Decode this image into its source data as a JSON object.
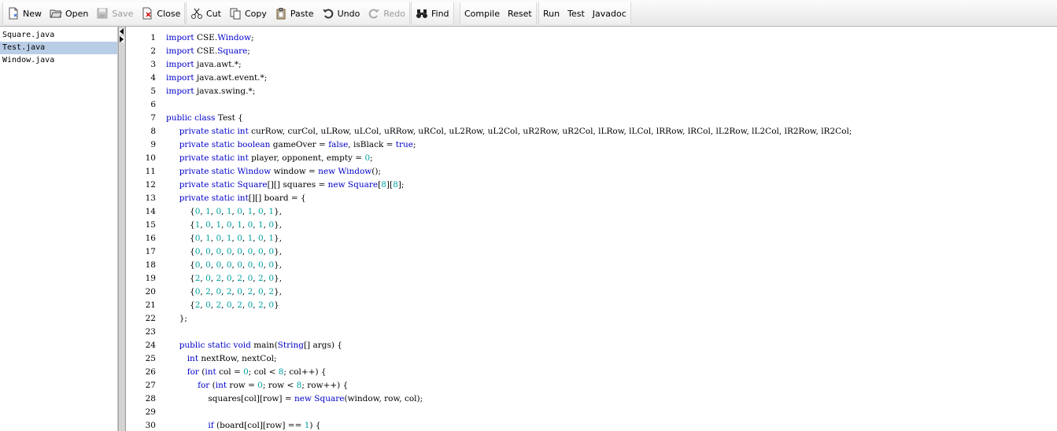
{
  "toolbar": {
    "buttons": [
      {
        "label": "New",
        "icon": "new-file-icon",
        "enabled": true
      },
      {
        "label": "Open",
        "icon": "open-folder-icon",
        "enabled": true
      },
      {
        "label": "Save",
        "icon": "save-disk-icon",
        "enabled": false
      },
      {
        "label": "Close",
        "icon": "close-file-icon",
        "enabled": true
      },
      {
        "label": "Cut",
        "icon": "scissors-icon",
        "enabled": true
      },
      {
        "label": "Copy",
        "icon": "copy-icon",
        "enabled": true
      },
      {
        "label": "Paste",
        "icon": "paste-clipboard-icon",
        "enabled": true
      },
      {
        "label": "Undo",
        "icon": "undo-icon",
        "enabled": true
      },
      {
        "label": "Redo",
        "icon": "redo-icon",
        "enabled": false
      },
      {
        "label": "Find",
        "icon": "binoculars-icon",
        "enabled": true
      },
      {
        "label": "Compile",
        "enabled": true
      },
      {
        "label": "Reset",
        "enabled": true
      },
      {
        "label": "Run",
        "enabled": true
      },
      {
        "label": "Test",
        "enabled": true
      },
      {
        "label": "Javadoc",
        "enabled": true
      }
    ]
  },
  "files": [
    {
      "name": "Square.java",
      "selected": false
    },
    {
      "name": "Test.java",
      "selected": true
    },
    {
      "name": "Window.java",
      "selected": false
    }
  ],
  "colors": {
    "keyword": "#0000c8",
    "number": "#00a0a0",
    "selection": "#b9cde6"
  },
  "code": {
    "lines": [
      "import CSE.Window;",
      "import CSE.Square;",
      "import java.awt.*;",
      "import java.awt.event.*;",
      "import javax.swing.*;",
      "",
      "public class Test {",
      "     private static int curRow, curCol, uLRow, uLCol, uRRow, uRCol, uL2Row, uL2Col, uR2Row, uR2Col, lLRow, lLCol, lRRow, lRCol, lL2Row, lL2Col, lR2Row, lR2Col;",
      "     private static boolean gameOver = false, isBlack = true;",
      "     private static int player, opponent, empty = 0;",
      "     private static Window window = new Window();",
      "     private static Square[][] squares = new Square[8][8];",
      "     private static int[][] board = {",
      "         {0, 1, 0, 1, 0, 1, 0, 1},",
      "         {1, 0, 1, 0, 1, 0, 1, 0},",
      "         {0, 1, 0, 1, 0, 1, 0, 1},",
      "         {0, 0, 0, 0, 0, 0, 0, 0},",
      "         {0, 0, 0, 0, 0, 0, 0, 0},",
      "         {2, 0, 2, 0, 2, 0, 2, 0},",
      "         {0, 2, 0, 2, 0, 2, 0, 2},",
      "         {2, 0, 2, 0, 2, 0, 2, 0}",
      "     };",
      "",
      "     public static void main(String[] args) {",
      "        int nextRow, nextCol;",
      "        for (int col = 0; col < 8; col++) {",
      "            for (int row = 0; row < 8; row++) {",
      "                squares[col][row] = new Square(window, row, col);",
      "",
      "                if (board[col][row] == 1) {"
    ]
  }
}
